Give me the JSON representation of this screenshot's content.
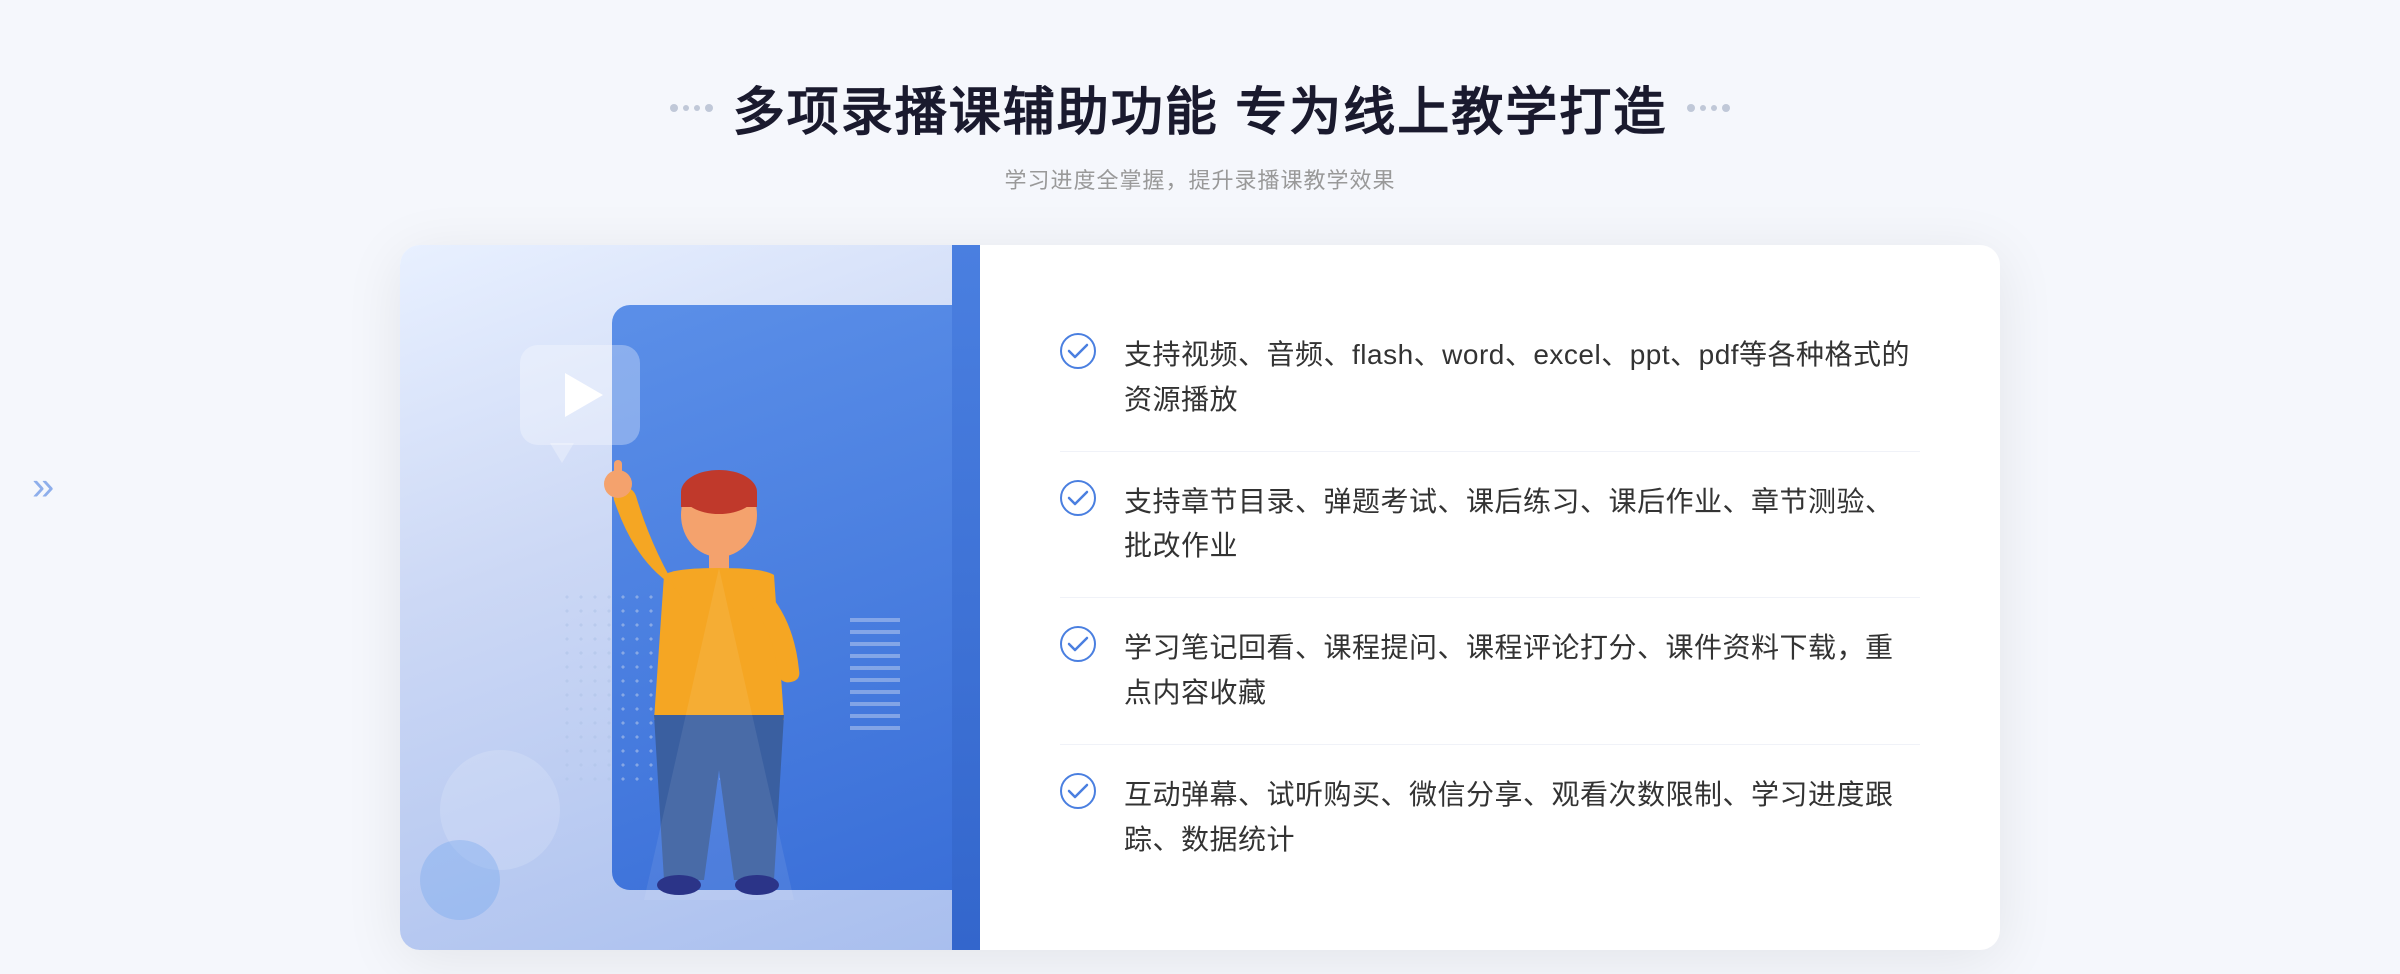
{
  "header": {
    "title": "多项录播课辅助功能 专为线上教学打造",
    "subtitle": "学习进度全掌握，提升录播课教学效果"
  },
  "features": [
    {
      "id": "feature-1",
      "text": "支持视频、音频、flash、word、excel、ppt、pdf等各种格式的资源播放"
    },
    {
      "id": "feature-2",
      "text": "支持章节目录、弹题考试、课后练习、课后作业、章节测验、批改作业"
    },
    {
      "id": "feature-3",
      "text": "学习笔记回看、课程提问、课程评论打分、课件资料下载，重点内容收藏"
    },
    {
      "id": "feature-4",
      "text": "互动弹幕、试听购买、微信分享、观看次数限制、学习进度跟踪、数据统计"
    }
  ],
  "nav": {
    "left_chevron": "«"
  },
  "colors": {
    "primary": "#4a7fe0",
    "title": "#1a1a2e",
    "text": "#333333",
    "subtitle": "#999999",
    "card_bg": "#ffffff",
    "left_panel_start": "#e8f0ff",
    "left_panel_end": "#a8beee",
    "blue_accent": "#3a6fd8"
  }
}
